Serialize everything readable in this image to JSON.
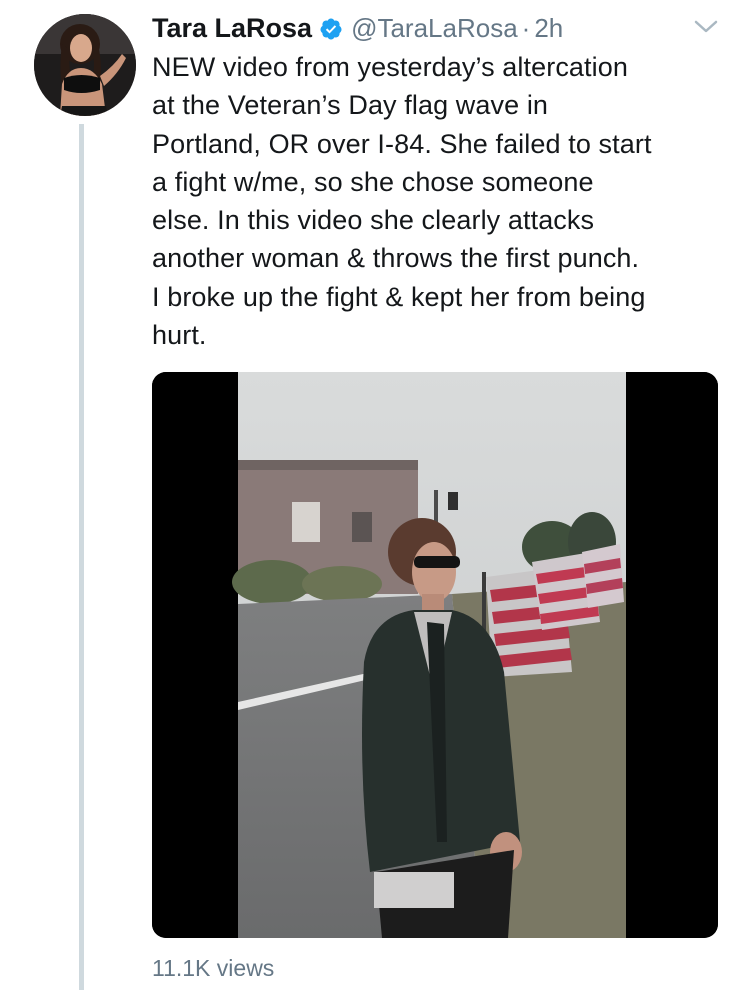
{
  "tweet": {
    "author_name": "Tara LaRosa",
    "handle": "@TaraLaRosa",
    "separator": "·",
    "timestamp": "2h",
    "text": "NEW video from yesterday’s altercation\nat the Veteran’s Day flag wave in\nPortland, OR over I-84. She failed to start\na fight w/me, so she chose someone\nelse. In this video she clearly attacks\nanother woman & throws the first punch.\nI broke up the fight & kept her from being\nhurt.",
    "views": "11.1K views"
  },
  "icons": {
    "verified": "verified-badge-icon",
    "menu": "chevron-down-icon"
  },
  "colors": {
    "text": "#14171a",
    "secondary": "#657786",
    "verified": "#1da1f2",
    "thread_line": "#cfd9de"
  }
}
